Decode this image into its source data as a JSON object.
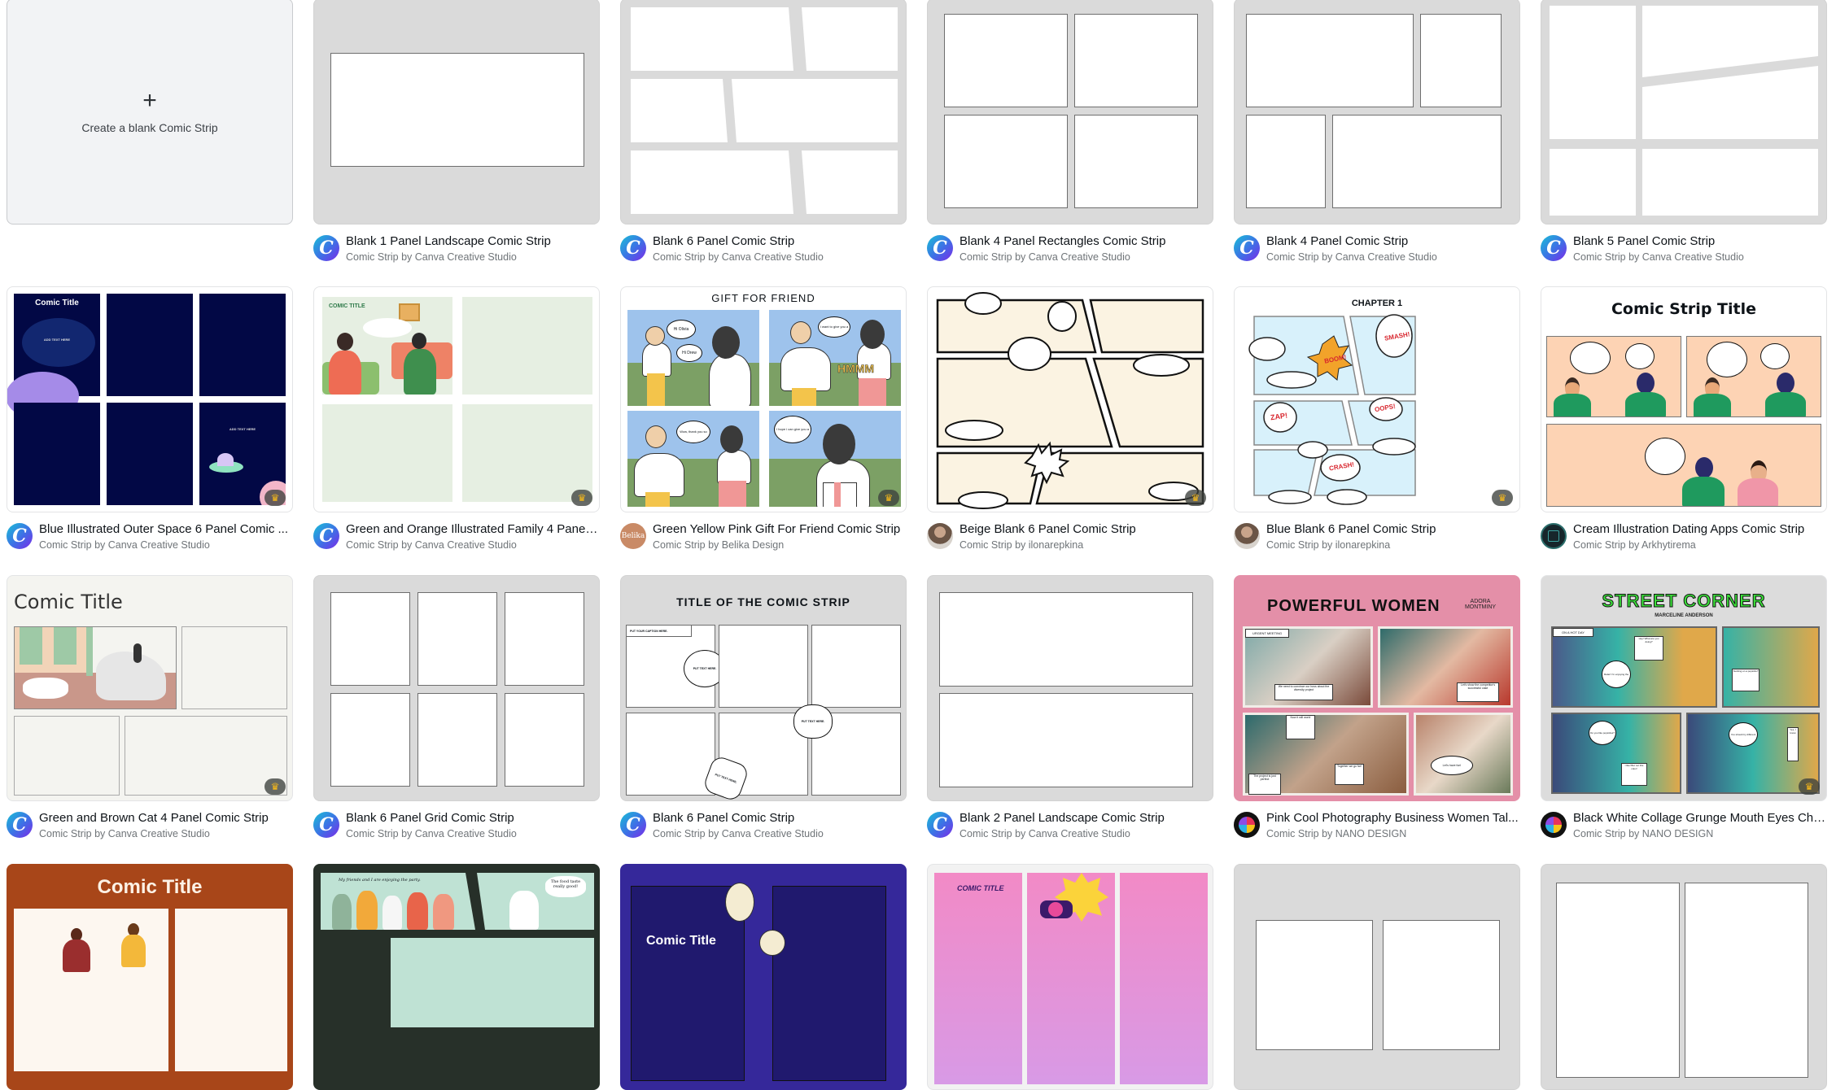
{
  "create_blank": {
    "icon": "+",
    "label": "Create a blank Comic Strip"
  },
  "templates": [
    {
      "title": "Blank 1 Panel Landscape Comic Strip",
      "subtitle": "Comic Strip by Canva Creative Studio",
      "avatar": "C",
      "premium": false
    },
    {
      "title": "Blank 6 Panel Comic Strip",
      "subtitle": "Comic Strip by Canva Creative Studio",
      "avatar": "C",
      "premium": false
    },
    {
      "title": "Blank 4 Panel Rectangles Comic Strip",
      "subtitle": "Comic Strip by Canva Creative Studio",
      "avatar": "C",
      "premium": false
    },
    {
      "title": "Blank 4 Panel Comic Strip",
      "subtitle": "Comic Strip by Canva Creative Studio",
      "avatar": "C",
      "premium": false
    },
    {
      "title": "Blank 5 Panel Comic Strip",
      "subtitle": "Comic Strip by Canva Creative Studio",
      "avatar": "C",
      "premium": false
    },
    {
      "title": "Blue Illustrated Outer Space 6 Panel Comic ...",
      "subtitle": "Comic Strip by Canva Creative Studio",
      "avatar": "C",
      "premium": true,
      "thumb_text": [
        "Comic Title",
        "ADD TEXT HERE",
        "ADD TEXT HERE"
      ]
    },
    {
      "title": "Green and Orange Illustrated Family 4 Panel ...",
      "subtitle": "Comic Strip by Canva Creative Studio",
      "avatar": "C",
      "premium": true,
      "thumb_text": [
        "COMIC TITLE"
      ]
    },
    {
      "title": "Green Yellow Pink Gift For Friend Comic Strip",
      "subtitle": "Comic Strip by Belika Design",
      "avatar": "Belika",
      "premium": true,
      "thumb_text": [
        "GIFT FOR FRIEND",
        "Hi Olivia",
        "Hi Drew",
        "I want to give you a gift",
        "HMMM",
        "Wow, thank you so much",
        "I hope i can give you a present too"
      ]
    },
    {
      "title": "Beige Blank 6 Panel Comic Strip",
      "subtitle": "Comic Strip by ilonarepkina",
      "avatar": "",
      "premium": true
    },
    {
      "title": "Blue Blank 6 Panel Comic Strip",
      "subtitle": "Comic Strip by ilonarepkina",
      "avatar": "",
      "premium": true,
      "thumb_text": [
        "CHAPTER 1",
        "BOOM!",
        "SMASH!",
        "ZAP!",
        "OOPS!",
        "CRASH!"
      ]
    },
    {
      "title": "Cream Illustration Dating Apps Comic Strip",
      "subtitle": "Comic Strip by Arkhytirema",
      "avatar": "",
      "premium": false,
      "thumb_text": [
        "Comic Strip Title"
      ]
    },
    {
      "title": "Green and Brown Cat 4 Panel Comic Strip",
      "subtitle": "Comic Strip by Canva Creative Studio",
      "avatar": "C",
      "premium": true,
      "thumb_text": [
        "Comic Title"
      ]
    },
    {
      "title": "Blank 6 Panel Grid Comic Strip",
      "subtitle": "Comic Strip by Canva Creative Studio",
      "avatar": "C",
      "premium": false
    },
    {
      "title": "Blank 6 Panel Comic Strip",
      "subtitle": "Comic Strip by Canva Creative Studio",
      "avatar": "C",
      "premium": false,
      "thumb_text": [
        "TITLE OF THE COMIC STRIP",
        "PUT YOUR CAPTION HERE.",
        "PUT TEXT HERE.",
        "PUT TEXT HERE.",
        "PUT TEXT HERE."
      ]
    },
    {
      "title": "Blank 2 Panel Landscape Comic Strip",
      "subtitle": "Comic Strip by Canva Creative Studio",
      "avatar": "C",
      "premium": false
    },
    {
      "title": "Pink Cool Photography Business Women Tal...",
      "subtitle": "Comic Strip by NANO DESIGN",
      "avatar": "",
      "premium": false,
      "thumb_text": [
        "POWERFUL WOMEN",
        "ADORA MONTMINY",
        "URGENT MEETING",
        "We need to convince our boss about the diversity project",
        "Let's show the competitor's successful case",
        "Now it will work!",
        "Together we go far!",
        "The project is just perfect",
        "Let's have fun!"
      ]
    },
    {
      "title": "Black White Collage Grunge Mouth Eyes Cha...",
      "subtitle": "Comic Strip by NANO DESIGN",
      "avatar": "",
      "premium": true,
      "thumb_text": [
        "STREET CORNER",
        "MARCELINE ANDERSON",
        "ON A HOT DAY",
        "Hey! What are you doing?",
        "Relax! I'm enjoying the summer!",
        "Sucking on a popsicle?",
        "Do you like popsicles?",
        "I like! But not this color!",
        "You should try different things!",
        "Yes, I know"
      ]
    },
    {
      "title_thumb": "Comic Title"
    },
    {
      "title_thumb": "My friends and I are enjoying the party.",
      "bubble": "The food taste really good!"
    },
    {
      "title_thumb": "Comic Title"
    },
    {
      "title_thumb": "COMIC TITLE"
    },
    {
      "title_thumb": ""
    },
    {
      "title_thumb": ""
    }
  ],
  "colors": {
    "canva_gradient": [
      "#18c0d6",
      "#7d2ae8"
    ],
    "premium_crown": "#f6b81a",
    "blank_bg": "#dadada",
    "title_text": "#0e1318",
    "subtitle_text": "#6f7478"
  }
}
